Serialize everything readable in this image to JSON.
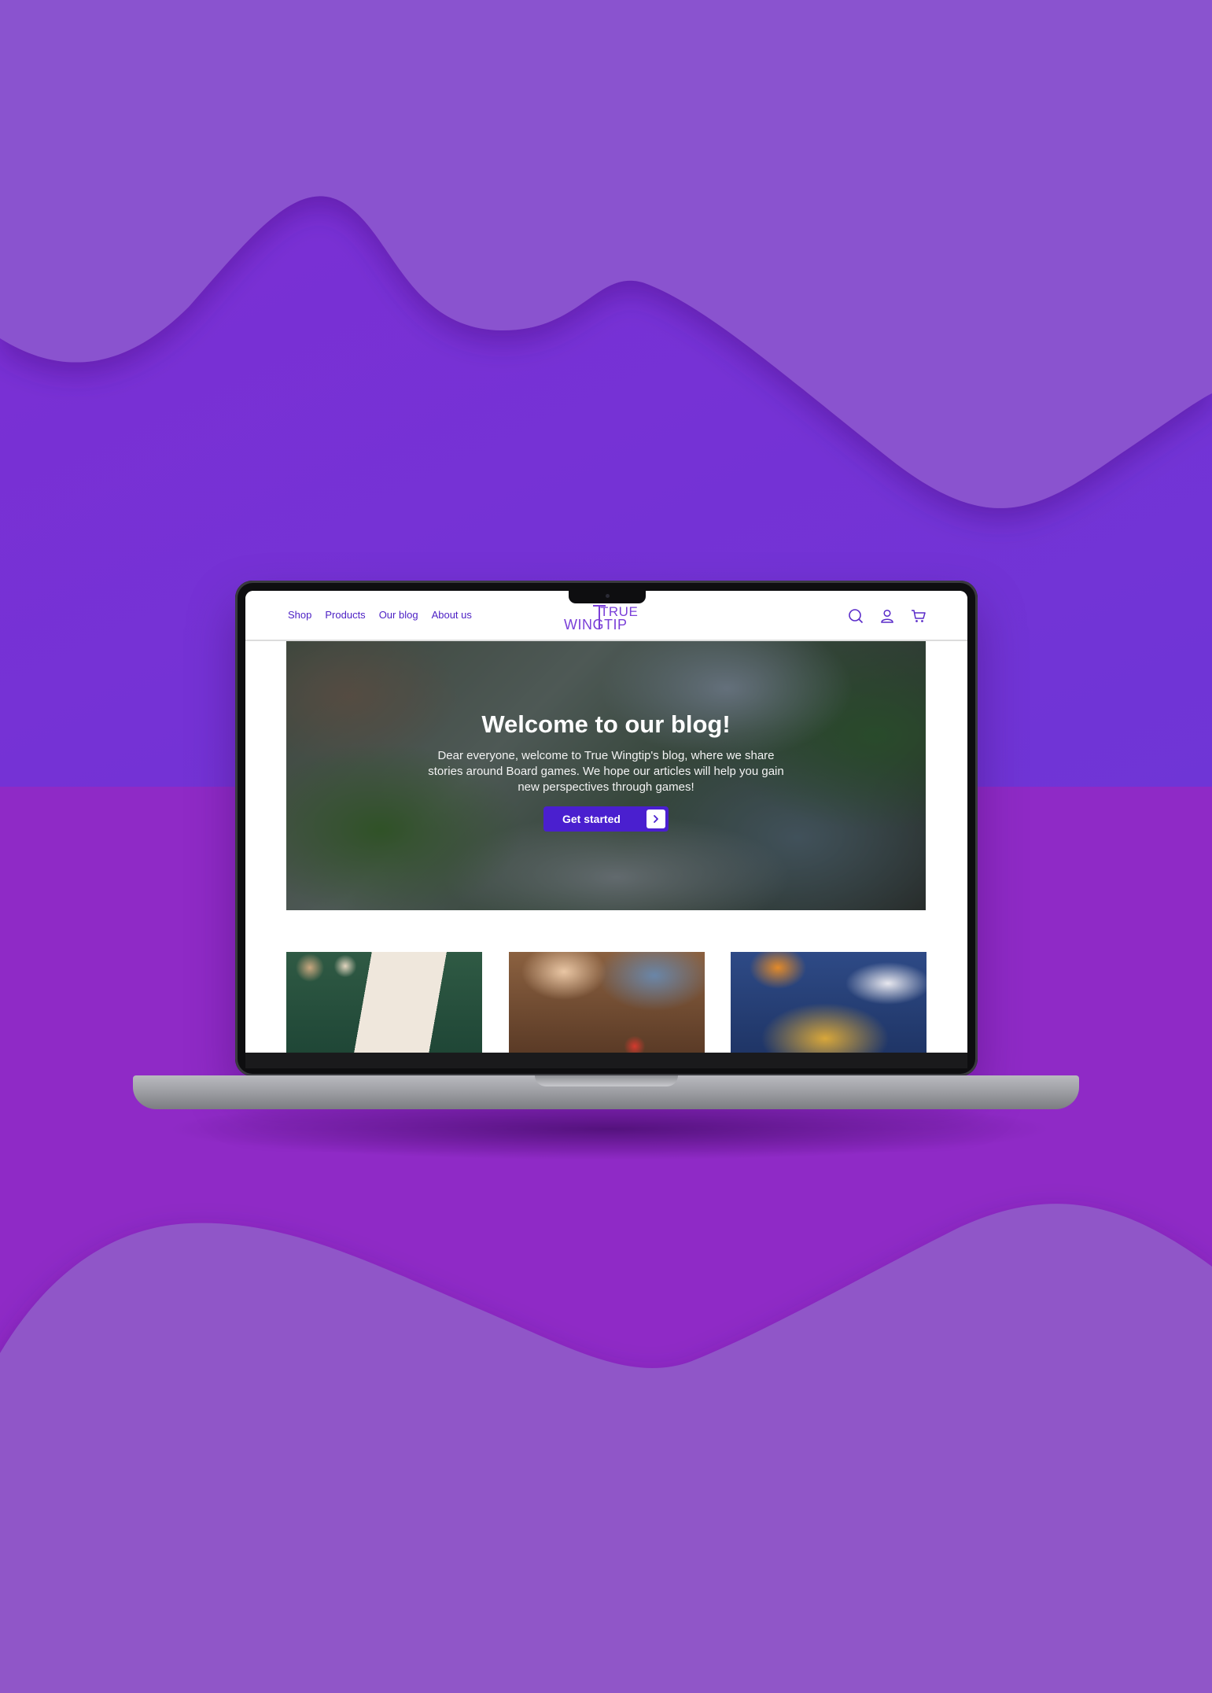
{
  "nav": {
    "items": [
      {
        "label": "Shop"
      },
      {
        "label": "Products"
      },
      {
        "label": "Our blog"
      },
      {
        "label": "About us"
      }
    ]
  },
  "logo": {
    "top": "TRUE",
    "bottom": "WINGTIP"
  },
  "hero": {
    "title": "Welcome to our blog!",
    "text": "Dear everyone, welcome to True Wingtip's blog, where we share stories around Board games. We hope our articles will help you gain new perspectives through games!",
    "cta_label": "Get started"
  },
  "icons": {
    "search": "search-icon",
    "account": "user-icon",
    "cart": "cart-icon",
    "cta_arrow": "chevron-right-icon"
  },
  "colors": {
    "brand": "#4b1fc4",
    "logo": "#7a3fd8",
    "background_top": "#8a4fcf",
    "background_mid": "#8c25c5"
  }
}
